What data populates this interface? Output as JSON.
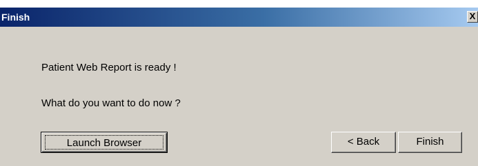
{
  "window": {
    "title": "Finish",
    "close_label": "X"
  },
  "content": {
    "message_ready": "Patient Web Report is ready !",
    "message_prompt": "What do you want to do now ?"
  },
  "buttons": {
    "launch_browser": "Launch Browser",
    "back": "< Back",
    "finish": "Finish"
  },
  "colors": {
    "titlebar_start": "#0a246a",
    "titlebar_end": "#a6caf0",
    "dialog_face": "#d4d0c8",
    "title_text": "#ffffff"
  }
}
